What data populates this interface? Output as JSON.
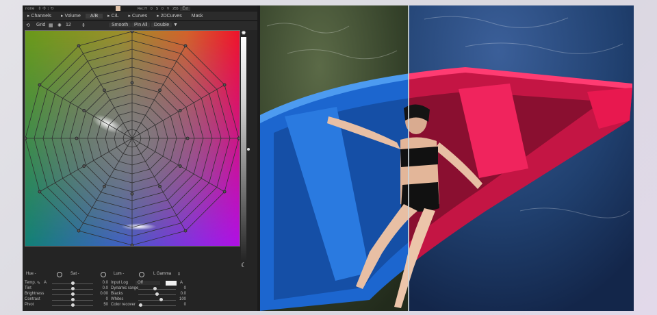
{
  "toolbar": {
    "preset_label": "none",
    "zoom_label": "Ext",
    "readouts": [
      "Rec H",
      "0",
      "S",
      "0",
      "V",
      "255"
    ]
  },
  "menu": {
    "items": [
      {
        "label": "Channels",
        "selected": false
      },
      {
        "label": "Volume",
        "selected": false
      },
      {
        "label": "A/B",
        "selected": true
      },
      {
        "label": "C/L",
        "selected": false
      },
      {
        "label": "Curves",
        "selected": false
      },
      {
        "label": "2DCurves",
        "selected": false
      },
      {
        "label": "Mask",
        "selected": false
      }
    ]
  },
  "tools": {
    "grid_label": "Grid",
    "points_value": "12",
    "smooth_label": "Smooth",
    "pin_all_label": "Pin All",
    "double_label": "Double"
  },
  "hsl": {
    "hue_label": "Hue -",
    "sat_label": "Sat -",
    "lum_label": "Lum -",
    "mode_label": "L Gamma"
  },
  "left_sliders": [
    {
      "label": "Temp.",
      "value": "0.0",
      "position": 0.5
    },
    {
      "label": "Tint",
      "value": "0.0",
      "position": 0.5
    },
    {
      "label": "Brightness",
      "value": "0.00",
      "position": 0.5
    },
    {
      "label": "Contrast",
      "value": "0",
      "position": 0.5
    },
    {
      "label": "Pivot",
      "value": "50",
      "position": 0.5
    }
  ],
  "right_panel": {
    "input_log_label": "Input Log",
    "input_log_value": "Off",
    "picker_label": "A"
  },
  "right_sliders": [
    {
      "label": "Dynamic range",
      "value": "0",
      "position": 0.45
    },
    {
      "label": "Blacks",
      "value": "0.0",
      "position": 0.5
    },
    {
      "label": "Whites",
      "value": "100",
      "position": 0.62
    },
    {
      "label": "Color recover",
      "value": "0",
      "position": 0.05
    }
  ],
  "colors": {
    "panel_bg": "#242424",
    "boat_left": "#1e6fd6",
    "boat_right": "#d8174a",
    "water_left": "#3b4a2c",
    "water_right": "#1f3c6e"
  },
  "icons": {
    "lum_top": "sun-icon",
    "lum_bottom": "moon-icon"
  }
}
